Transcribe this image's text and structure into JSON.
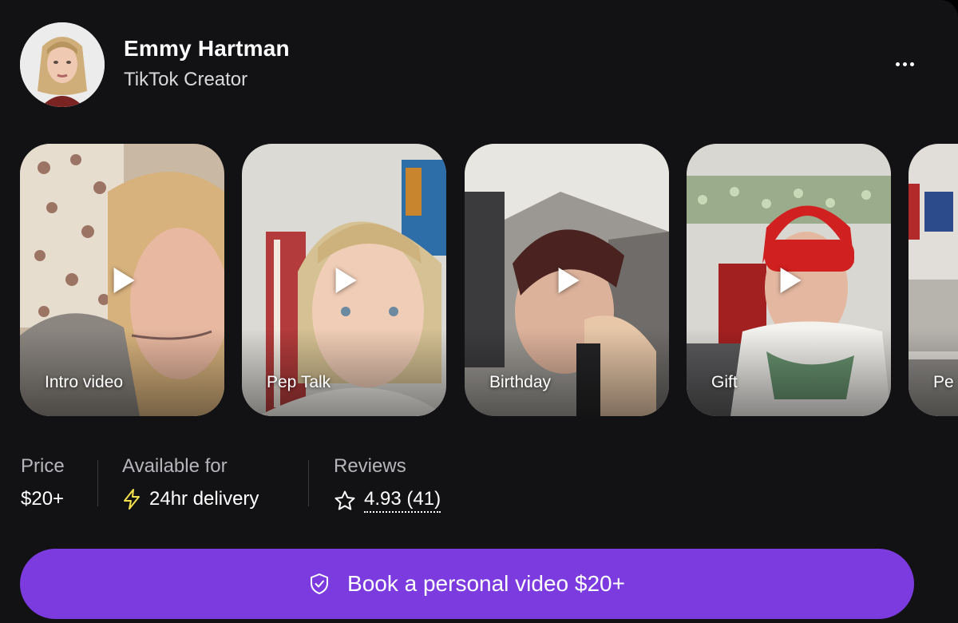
{
  "profile": {
    "name": "Emmy Hartman",
    "subtitle": "TikTok Creator",
    "more_icon": "more-horizontal-icon"
  },
  "videos": [
    {
      "label": "Intro video"
    },
    {
      "label": "Pep Talk"
    },
    {
      "label": "Birthday"
    },
    {
      "label": "Gift"
    },
    {
      "label": "Pe"
    }
  ],
  "stats": {
    "price": {
      "label": "Price",
      "value": "$20+"
    },
    "availability": {
      "label": "Available for",
      "value": "24hr delivery",
      "icon": "lightning-bolt-icon"
    },
    "reviews": {
      "label": "Reviews",
      "value": "4.93 (41)",
      "icon": "star-outline-icon"
    }
  },
  "cta": {
    "label": "Book a personal video $20+",
    "icon": "shield-check-icon"
  },
  "colors": {
    "background": "#121214",
    "accent": "#7c3bdf",
    "bolt": "#f4e04d",
    "muted_text": "#b5b5ba"
  }
}
